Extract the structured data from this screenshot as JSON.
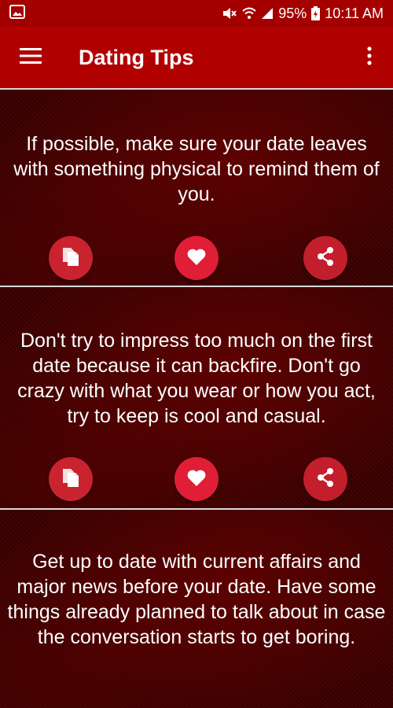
{
  "status_bar": {
    "battery": "95%",
    "time": "10:11 AM",
    "icons": [
      "image-icon",
      "mute-icon",
      "wifi-icon",
      "signal-icon",
      "battery-icon"
    ]
  },
  "app_bar": {
    "title": "Dating Tips",
    "left_icon": "hamburger-menu-icon",
    "right_icon": "more-vertical-icon"
  },
  "tips": [
    {
      "text": "If possible, make sure your date leaves with something physical to remind them of you."
    },
    {
      "text": "Don't try to impress too much on the first date because it can backfire. Don't go crazy with what you wear or how you act, try to keep is cool and casual."
    },
    {
      "text": "Get up to date with current affairs and major news before your date. Have some things already planned to talk about in case the conversation starts to get boring."
    }
  ],
  "card_actions": [
    "copy-icon",
    "heart-icon",
    "share-icon"
  ],
  "colors": {
    "status_bar": "#a40000",
    "app_bar": "#b10000",
    "card_background": "#3c0000",
    "copy_button": "#c9232f",
    "favorite_button": "#e01e35",
    "share_button": "#c21e2c"
  }
}
